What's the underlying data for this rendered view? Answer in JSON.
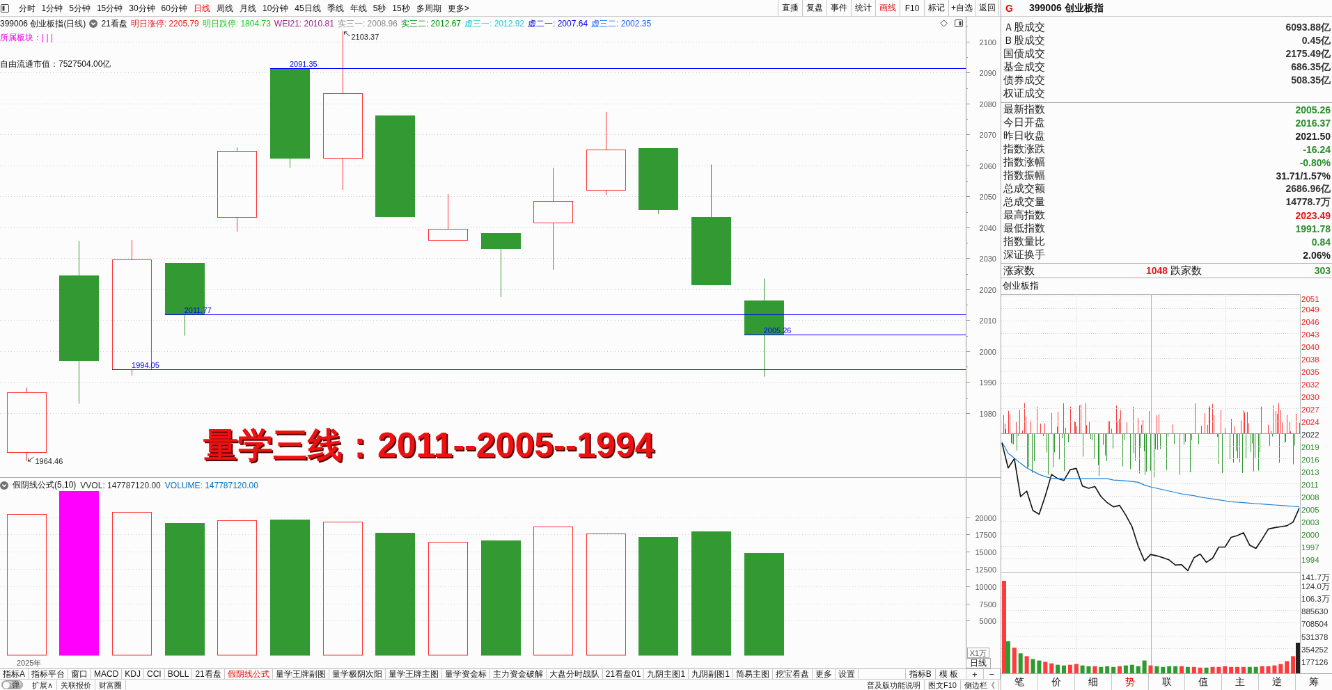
{
  "toolbar": {
    "periods": [
      {
        "label": "分时",
        "selected": false
      },
      {
        "label": "1分钟",
        "selected": false
      },
      {
        "label": "5分钟",
        "selected": false
      },
      {
        "label": "15分钟",
        "selected": false
      },
      {
        "label": "30分钟",
        "selected": false
      },
      {
        "label": "60分钟",
        "selected": false
      },
      {
        "label": "日线",
        "selected": true
      },
      {
        "label": "周线",
        "selected": false
      },
      {
        "label": "月线",
        "selected": false
      },
      {
        "label": "10分钟",
        "selected": false
      },
      {
        "label": "45日线",
        "selected": false
      },
      {
        "label": "季线",
        "selected": false
      },
      {
        "label": "年线",
        "selected": false
      },
      {
        "label": "5秒",
        "selected": false
      },
      {
        "label": "15秒",
        "selected": false
      },
      {
        "label": "多周期",
        "selected": false
      },
      {
        "label": "更多>",
        "selected": false
      }
    ],
    "tools": [
      {
        "label": "直播",
        "active": false
      },
      {
        "label": "复盘",
        "active": false
      },
      {
        "label": "事件",
        "active": false
      },
      {
        "label": "统计",
        "active": false
      },
      {
        "label": "画线",
        "active": true
      },
      {
        "label": "F10",
        "active": false
      },
      {
        "label": "标记",
        "active": false
      },
      {
        "label": "+自选",
        "active": false
      },
      {
        "label": "返回",
        "active": false
      }
    ]
  },
  "main_chart": {
    "title": "399006 创业板指(日线)",
    "template": "21看盘",
    "legend": [
      {
        "label": "明日涨停: 2205.79",
        "color": "#e51c1c"
      },
      {
        "label": "明日跌停: 1804.73",
        "color": "#1ec81e"
      },
      {
        "label": "WEI21: 2010.81",
        "color": "#99208a"
      },
      {
        "label": "实三一: 2008.96",
        "color": "#8c8c8c"
      },
      {
        "label": "实三二: 2012.67",
        "color": "#008a00"
      },
      {
        "label": "虚三一: 2012.92",
        "color": "#1cc8d8"
      },
      {
        "label": "虚二一: 2007.64",
        "color": "#0000e0"
      },
      {
        "label": "虚三二: 2002.35",
        "color": "#1a5cff"
      }
    ],
    "sector": "所属板块：| | |",
    "float_cap": "自由流通市值：7527504.00亿",
    "caption": "量学三线：2011--2005--1994",
    "chart_data": [
      {
        "type": "candlestick",
        "categories": [
          null,
          null,
          null,
          null,
          null,
          null,
          null,
          null,
          null,
          null,
          null,
          null,
          null,
          null,
          null,
          null,
          null,
          null,
          null
        ],
        "ohlc": [
          [
            1967.4,
            1988.2,
            1964.46,
            1986.8
          ],
          [
            2024.4,
            2035.6,
            1983.0,
            1997.0
          ],
          [
            1994.05,
            2035.9,
            1992.1,
            2029.6
          ],
          [
            2028.5,
            2028.5,
            2005.0,
            2011.77
          ],
          [
            2043.3,
            2065.8,
            2038.6,
            2064.7
          ],
          [
            2091.35,
            2091.35,
            2059.2,
            2062.5
          ],
          [
            2062.5,
            2103.37,
            2052.1,
            2083.3
          ],
          [
            2076.2,
            2076.2,
            2043.4,
            2043.6
          ],
          [
            2035.9,
            2050.7,
            2035.9,
            2039.5
          ],
          [
            2038.1,
            2038.1,
            2017.5,
            2033.2
          ],
          [
            2041.6,
            2059.2,
            2026.3,
            2048.5
          ],
          [
            2052.1,
            2077.3,
            2050.4,
            2065.2
          ],
          [
            2065.5,
            2065.5,
            2044.4,
            2045.8
          ],
          [
            2043.3,
            2060.3,
            2021.5,
            2021.5
          ],
          [
            2016.37,
            2023.49,
            1991.78,
            2005.26
          ],
          null,
          null,
          null,
          null
        ],
        "ylim": [
          1959.3,
          2108.05
        ],
        "yticks": [
          1980,
          1990,
          2000,
          2010,
          2020,
          2030,
          2040,
          2050,
          2060,
          2070,
          2080,
          2090,
          2100
        ],
        "grid": true,
        "ref_lines": [
          {
            "axis": "y",
            "value": 2091.35,
            "label": "2091.35",
            "color": "#0000ff"
          },
          {
            "axis": "y",
            "value": 2011.77,
            "label": "2011.77",
            "color": "#0000ff"
          },
          {
            "axis": "y",
            "value": 2005.26,
            "label": "2005.26",
            "color": "#0000ff"
          },
          {
            "axis": "y",
            "value": 1994.05,
            "label": "1994.05",
            "color": "#0000ff"
          }
        ],
        "annotations": [
          "2103.37",
          "1964.46"
        ]
      }
    ]
  },
  "volume_panel": {
    "title": "假阴线公式(5,10)",
    "readings": [
      {
        "label": "VVOL: 147787120.00",
        "color": "#333333"
      },
      {
        "label": "VOLUME: 147787120.00",
        "color": "#0070c0"
      }
    ],
    "period": "日线",
    "chart_data": [
      {
        "type": "bar",
        "categories": [
          null,
          null,
          null,
          null,
          null,
          null,
          null,
          null,
          null,
          null,
          null,
          null,
          null,
          null,
          null,
          null,
          null,
          null,
          null
        ],
        "values": [
          20500,
          23800,
          20800,
          19200,
          19600,
          19700,
          19400,
          17700,
          16400,
          16600,
          18600,
          17600,
          17100,
          17900,
          14800,
          null,
          null,
          null,
          null
        ],
        "colors": [
          "#ff3232",
          "#ff00ff",
          "#ff3232",
          "#339933",
          "#ff3232",
          "#339933",
          "#ff3232",
          "#339933",
          "#ff3232",
          "#339933",
          "#ff3232",
          "#ff3232",
          "#339933",
          "#339933",
          "#339933",
          null,
          null,
          null,
          null
        ],
        "ylim": [
          0,
          25706
        ],
        "yticks": [
          5000,
          7500,
          10000,
          12500,
          15000,
          17500,
          20000
        ],
        "ylabel": "X1万",
        "xlabel": "2025年",
        "grid": true
      }
    ]
  },
  "indicator_bar": {
    "tabs": [
      {
        "label": "指标A",
        "selected": false
      },
      {
        "label": "指标平台",
        "selected": false
      },
      {
        "label": "窗口",
        "selected": false
      },
      {
        "label": "MACD",
        "selected": false
      },
      {
        "label": "KDJ",
        "selected": false
      },
      {
        "label": "CCI",
        "selected": false
      },
      {
        "label": "BOLL",
        "selected": false
      },
      {
        "label": "21看盘",
        "selected": false
      },
      {
        "label": "假阴线公式",
        "selected": true
      },
      {
        "label": "量学王牌副图",
        "selected": false
      },
      {
        "label": "量学极阴次阳",
        "selected": false
      },
      {
        "label": "量学王牌主图",
        "selected": false
      },
      {
        "label": "量学资金标",
        "selected": false
      },
      {
        "label": "主力资金破解",
        "selected": false
      },
      {
        "label": "大盘分时战队",
        "selected": false
      },
      {
        "label": "21看盘01",
        "selected": false
      },
      {
        "label": "九阴主图1",
        "selected": false
      },
      {
        "label": "九阴副图1",
        "selected": false
      },
      {
        "label": "简易主图",
        "selected": false
      },
      {
        "label": "挖宝看盘",
        "selected": false
      },
      {
        "label": "更多",
        "selected": false
      },
      {
        "label": "设置",
        "selected": false
      }
    ],
    "right": [
      "指标B",
      "模 板"
    ],
    "zoom": [
      "+",
      "−"
    ]
  },
  "status_bar": {
    "toggle": {
      "label": "弹",
      "on": false
    },
    "left": [
      "扩展∧",
      "关联报价",
      "财富圈"
    ],
    "right": [
      "普及版功能说明",
      "图文F10",
      "侧边栏《"
    ]
  },
  "quote_panel": {
    "flag": "G",
    "name": "399006 创业板指",
    "turnover": [
      {
        "label": "Ａ股成交",
        "value": "6093.88亿"
      },
      {
        "label": "Ｂ股成交",
        "value": "0.45亿"
      },
      {
        "label": "国债成交",
        "value": "2175.49亿"
      },
      {
        "label": "基金成交",
        "value": "686.35亿"
      },
      {
        "label": "债券成交",
        "value": "508.35亿"
      },
      {
        "label": "权证成交"
      }
    ],
    "stats": [
      {
        "label": "最新指数",
        "value": "2005.26",
        "color": "#2a8c2a"
      },
      {
        "label": "今日开盘",
        "value": "2016.37",
        "color": "#2a8c2a"
      },
      {
        "label": "昨日收盘",
        "value": "2021.50",
        "color": "#222222"
      },
      {
        "label": "指数涨跌",
        "value": "-16.24",
        "color": "#2a8c2a"
      },
      {
        "label": "指数涨幅",
        "value": "-0.80%",
        "color": "#2a8c2a"
      },
      {
        "label": "指数振幅",
        "value": "31.71/1.57%",
        "color": "#222222"
      },
      {
        "label": "总成交额",
        "value": "2686.96亿",
        "color": "#333333"
      },
      {
        "label": "总成交量",
        "value": "14778.7万",
        "color": "#333333"
      },
      {
        "label": "最高指数",
        "value": "2023.49",
        "color": "#e8141e"
      },
      {
        "label": "最低指数",
        "value": "1991.78",
        "color": "#2a8c2a"
      },
      {
        "label": "指数量比",
        "value": "0.84",
        "color": "#2a8c2a"
      },
      {
        "label": "深证换手",
        "value": "2.06%",
        "color": "#222222"
      }
    ],
    "breadth": {
      "up_label": "涨家数",
      "up_count": "1048",
      "down_label": "跌家数",
      "down_count": "303"
    },
    "chart_label": "创业板指",
    "chart_data": [
      {
        "type": "line",
        "categories": [
          null,
          null,
          null,
          null,
          null,
          null,
          null,
          null,
          null,
          null,
          null,
          null,
          null,
          null,
          null,
          null,
          null,
          null,
          null,
          null,
          null,
          null,
          null,
          null,
          null,
          null,
          null,
          null,
          null,
          null,
          null,
          null,
          null,
          null,
          null,
          null,
          null,
          null,
          null,
          null,
          null,
          null,
          null,
          null,
          null,
          null,
          null,
          null,
          null
        ],
        "series": [
          {
            "color": "#111111",
            "values": [
              2019.4,
              2014.0,
              2016.0,
              2007.8,
              2009.0,
              2004.8,
              2004.0,
              2008.0,
              2012.6,
              2011.7,
              2011.3,
              2013.6,
              2013.9,
              2010.1,
              2009.6,
              2010.0,
              2007.8,
              2006.5,
              2005.6,
              2005.9,
              2003.8,
              2001.3,
              1997.1,
              1993.9,
              1995.3,
              1995.0,
              1994.6,
              1994.1,
              1993.0,
              1993.1,
              1991.8,
              1994.6,
              1995.4,
              1993.6,
              1994.5,
              1996.9,
              1996.9,
              1999.0,
              1999.4,
              2000.0,
              1997.3,
              1996.6,
              1998.6,
              2000.8,
              2001.1,
              2001.3,
              2001.5,
              2002.3,
              2005.3
            ]
          },
          {
            "color": "#1e7fd8",
            "values": [
              2019.6,
              2017.2,
              2016.1,
              2015.0,
              2014.0,
              2013.3,
              2012.6,
              2012.1,
              2011.8,
              2011.7,
              2011.7,
              2011.7,
              2011.7,
              2011.7,
              2011.7,
              2011.7,
              2011.7,
              2011.7,
              2011.4,
              2011.3,
              2011.2,
              2011.1,
              2010.9,
              2010.3,
              2009.9,
              2009.6,
              2009.3,
              2009.0,
              2008.7,
              2008.4,
              2008.2,
              2008.0,
              2007.7,
              2007.5,
              2007.3,
              2007.1,
              2006.9,
              2006.7,
              2006.6,
              2006.5,
              2006.4,
              2006.3,
              2006.2,
              2006.1,
              2006.0,
              2005.9,
              2005.8,
              2005.7,
              2005.6
            ]
          }
        ],
        "ylim": [
          1991.41,
          2051.56
        ],
        "yticks": [
          {
            "value": 1994.4,
            "label": "1994"
          },
          {
            "value": 1997.11,
            "label": "1997"
          },
          {
            "value": 1999.82,
            "label": "2000"
          },
          {
            "value": 2002.53,
            "label": "2003"
          },
          {
            "value": 2005.24,
            "label": "2005"
          },
          {
            "value": 2007.95,
            "label": "2008"
          },
          {
            "value": 2010.66,
            "label": "2011"
          },
          {
            "value": 2013.37,
            "label": "2013"
          },
          {
            "value": 2016.08,
            "label": "2016"
          },
          {
            "value": 2018.79,
            "label": "2019"
          },
          {
            "value": 2021.5,
            "label": "2022"
          },
          {
            "value": 2024.21,
            "label": "2024"
          },
          {
            "value": 2026.92,
            "label": "2027"
          },
          {
            "value": 2029.63,
            "label": "2030"
          },
          {
            "value": 2032.34,
            "label": "2032"
          },
          {
            "value": 2035.05,
            "label": "2035"
          },
          {
            "value": 2037.76,
            "label": "2038"
          },
          {
            "value": 2040.47,
            "label": "2040"
          },
          {
            "value": 2043.18,
            "label": "2043"
          },
          {
            "value": 2045.89,
            "label": "2046"
          },
          {
            "value": 2048.6,
            "label": "2049"
          },
          {
            "value": 2051.31,
            "label": "2051"
          }
        ],
        "grid": true,
        "ref_lines": [
          {
            "axis": "y",
            "value": 2021.5,
            "color": "#9a9a9a"
          }
        ]
      },
      {
        "type": "bar",
        "categories": [
          null,
          null,
          null,
          null,
          null,
          null,
          null,
          null,
          null,
          null,
          null,
          null,
          null,
          null,
          null,
          null,
          null,
          null,
          null,
          null,
          null,
          null,
          null,
          null,
          null,
          null,
          null,
          null,
          null,
          null,
          null,
          null,
          null,
          null,
          null,
          null,
          null,
          null,
          null,
          null,
          null,
          null,
          null,
          null,
          null,
          null,
          null,
          null,
          null
        ],
        "values": [
          1300000,
          450000,
          360000,
          280000,
          240000,
          200000,
          180000,
          160000,
          140000,
          120000,
          110000,
          120000,
          130000,
          110000,
          100000,
          100000,
          90000,
          100000,
          90000,
          100000,
          110000,
          120000,
          100000,
          180000,
          110000,
          100000,
          90000,
          100000,
          100000,
          100000,
          90000,
          90000,
          80000,
          80000,
          90000,
          90000,
          100000,
          90000,
          90000,
          90000,
          90000,
          90000,
          100000,
          100000,
          110000,
          130000,
          170000,
          240000,
          430000
        ],
        "colors": [
          "#ff3b3b",
          "#2e9b2e",
          "#ff3b3b",
          "#2e9b2e",
          "#ff3b3b",
          "#2e9b2e",
          "#2e9b2e",
          "#ff3b3b",
          "#ff3b3b",
          "#2e9b2e",
          "#2e9b2e",
          "#ff3b3b",
          "#ff3b3b",
          "#2e9b2e",
          "#2e9b2e",
          "#ff3b3b",
          "#2e9b2e",
          "#2e9b2e",
          "#2e9b2e",
          "#ff3b3b",
          "#2e9b2e",
          "#2e9b2e",
          "#2e9b2e",
          "#2e9b2e",
          "#ff3b3b",
          "#2e9b2e",
          "#2e9b2e",
          "#2e9b2e",
          "#2e9b2e",
          "#ff3b3b",
          "#2e9b2e",
          "#ff3b3b",
          "#ff3b3b",
          "#2e9b2e",
          "#ff3b3b",
          "#ff3b3b",
          "#ff3b3b",
          "#ff3b3b",
          "#ff3b3b",
          "#ff3b3b",
          "#2e9b2e",
          "#2e9b2e",
          "#ff3b3b",
          "#ff3b3b",
          "#ff3b3b",
          "#ff3b3b",
          "#ff3b3b",
          "#ff3b3b",
          "#222222"
        ],
        "ylim": [
          0,
          1417000
        ],
        "yticks": [
          177126,
          354252,
          531378,
          708504,
          885630
        ],
        "y2lim": [
          0,
          141.7
        ],
        "y2ticks": [
          {
            "value": 106.3,
            "label": "106.3万"
          },
          {
            "value": 124.0,
            "label": "124.0万"
          },
          {
            "value": 141.7,
            "label": "141.7万"
          }
        ],
        "grid": true
      }
    ],
    "tabs": [
      {
        "label": "笔",
        "selected": false
      },
      {
        "label": "价",
        "selected": false
      },
      {
        "label": "细",
        "selected": false
      },
      {
        "label": "势",
        "selected": true
      },
      {
        "label": "联",
        "selected": false
      },
      {
        "label": "值",
        "selected": false
      },
      {
        "label": "主",
        "selected": false
      },
      {
        "label": "逆",
        "selected": false
      },
      {
        "label": "筹",
        "selected": false
      }
    ]
  }
}
